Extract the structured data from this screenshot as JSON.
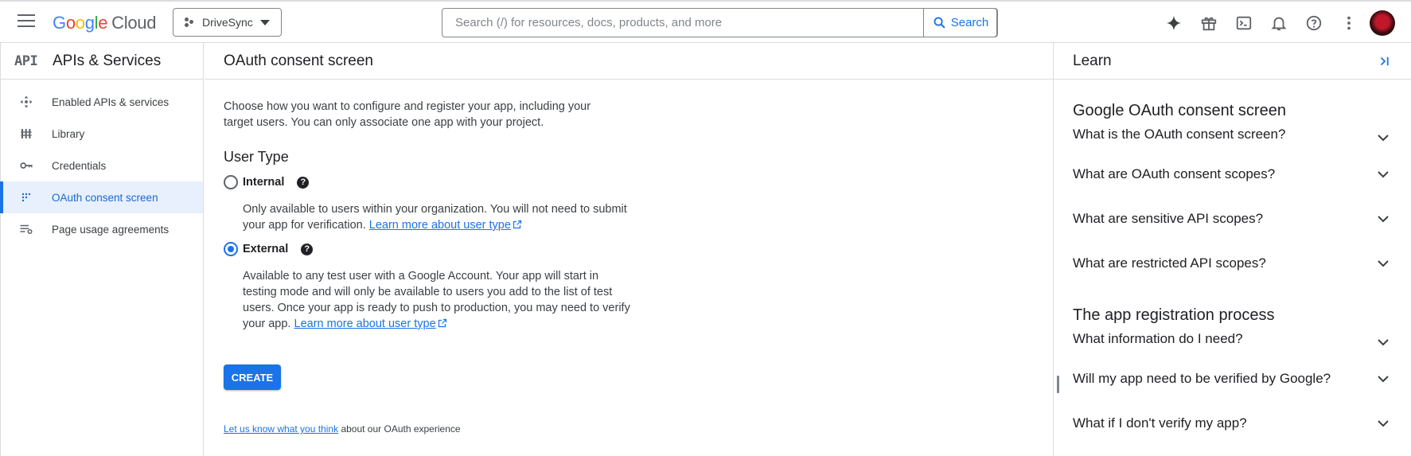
{
  "topbar": {
    "logo": [
      "G",
      "o",
      "o",
      "g",
      "l",
      "e"
    ],
    "logo_cloud": "Cloud",
    "project_name": "DriveSync",
    "search_placeholder": "Search (/) for resources, docs, products, and more",
    "search_button": "Search"
  },
  "sidebar": {
    "badge": "API",
    "title": "APIs & Services",
    "items": [
      {
        "label": "Enabled APIs & services",
        "icon": "move-icon"
      },
      {
        "label": "Library",
        "icon": "library-icon"
      },
      {
        "label": "Credentials",
        "icon": "key-icon"
      },
      {
        "label": "OAuth consent screen",
        "icon": "consent-grid-icon",
        "active": true
      },
      {
        "label": "Page usage agreements",
        "icon": "settings-list-icon"
      }
    ]
  },
  "main": {
    "title": "OAuth consent screen",
    "intro": "Choose how you want to configure and register your app, including your target users. You can only associate one app with your project.",
    "user_type_heading": "User Type",
    "internal": {
      "label": "Internal",
      "help": "?",
      "desc": "Only available to users within your organization. You will not need to submit your app for verification.",
      "link": "Learn more about user type",
      "selected": false
    },
    "external": {
      "label": "External",
      "help": "?",
      "desc": "Available to any test user with a Google Account. Your app will start in testing mode and will only be available to users you add to the list of test users. Once your app is ready to push to production, you may need to verify your app.",
      "link": "Learn more about user type",
      "selected": true
    },
    "create_button": "CREATE",
    "feedback_link": "Let us know what you think",
    "feedback_rest": "about our OAuth experience"
  },
  "learn": {
    "title": "Learn",
    "sections": [
      {
        "heading": "Google OAuth consent screen",
        "questions": [
          "What is the OAuth consent screen?",
          "What are OAuth consent scopes?",
          "What are sensitive API scopes?",
          "What are restricted API scopes?"
        ]
      },
      {
        "heading": "The app registration process",
        "questions": [
          "What information do I need?",
          "Will my app need to be verified by Google?",
          "What if I don't verify my app?"
        ]
      }
    ]
  },
  "colors": {
    "accent": "#1a73e8",
    "active_bg": "#e8f0fe",
    "border": "#dadce0"
  }
}
